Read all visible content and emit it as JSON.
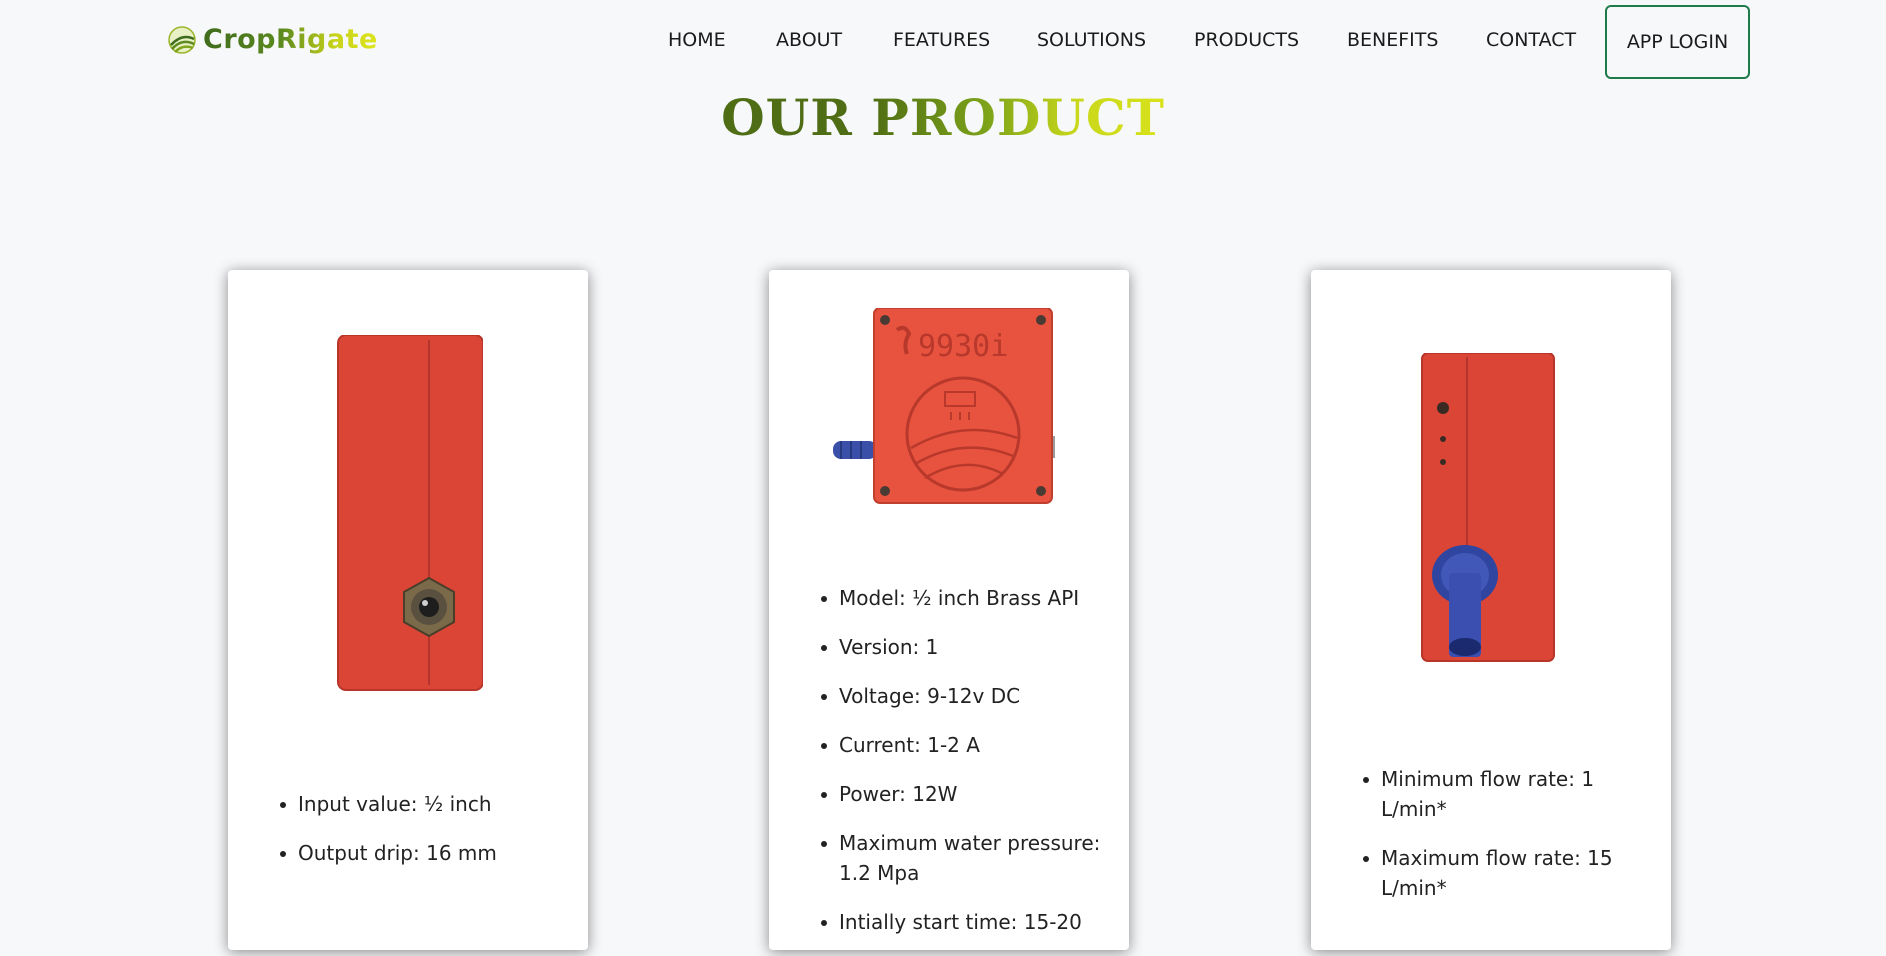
{
  "brand": {
    "name": "CropRigate"
  },
  "nav": {
    "items": [
      "HOME",
      "ABOUT",
      "FEATURES",
      "SOLUTIONS",
      "PRODUCTS",
      "BENEFITS",
      "CONTACT"
    ],
    "login_label": "APP LOGIN"
  },
  "section": {
    "title_part1": "OUR",
    "title_part2": "PRODUCT"
  },
  "products": [
    {
      "image_label": "",
      "specs": [
        "Input value: ½ inch",
        "Output drip: 16 mm"
      ]
    },
    {
      "image_label": "9930i",
      "specs": [
        "Model: ½ inch Brass API",
        "Version: 1",
        "Voltage: 9-12v DC",
        "Current: 1-2 A",
        "Power: 12W",
        "Maximum water pressure: 1.2 Mpa",
        "Intially start time: 15-20"
      ]
    },
    {
      "image_label": "",
      "specs": [
        "Minimum flow rate: 1 L/min*",
        "Maximum flow rate: 15 L/min*"
      ]
    }
  ],
  "colors": {
    "accent_green": "#1f7a4a",
    "brand_dark": "#4e6d14",
    "brand_light": "#d8e21b",
    "device_red": "#e24b3c"
  }
}
